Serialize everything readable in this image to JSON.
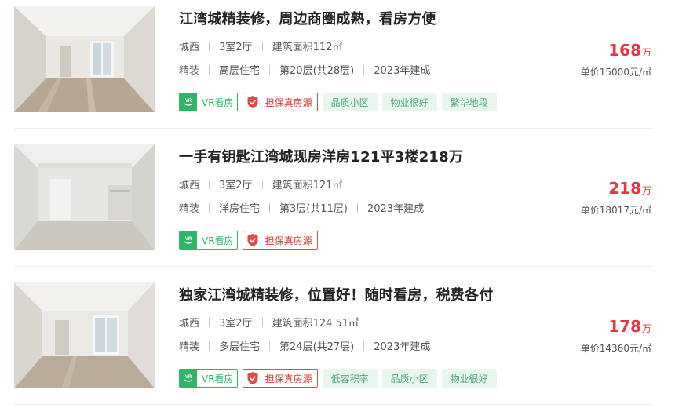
{
  "icons": {
    "vr": "vr-badge-icon",
    "guarantee": "shield-check-icon"
  },
  "colors": {
    "price_red": "#e8353f",
    "vr_green": "#2fb56a",
    "guard_red": "#e14a4a",
    "feature_bg": "#e8f6ee",
    "feature_text": "#4fa87a"
  },
  "listings": [
    {
      "title": "江湾城精装修，周边商圈成熟，看房方便",
      "district": "城西",
      "layout": "3室2厅",
      "area": "建筑面积112㎡",
      "decoration": "精装",
      "building_type": "高层住宅",
      "floor": "第20层(共28层)",
      "built": "2023年建成",
      "price_num": "168",
      "price_unit": "万",
      "unit_price": "单价15000元/㎡",
      "vr_label": "VR看房",
      "guarantee_label": "担保真房源",
      "features": [
        "品质小区",
        "物业很好",
        "繁华地段"
      ]
    },
    {
      "title": "一手有钥匙江湾城现房洋房121平3楼218万",
      "district": "城西",
      "layout": "3室2厅",
      "area": "建筑面积121㎡",
      "decoration": "精装",
      "building_type": "洋房住宅",
      "floor": "第3层(共11层)",
      "built": "2023年建成",
      "price_num": "218",
      "price_unit": "万",
      "unit_price": "单价18017元/㎡",
      "vr_label": "VR看房",
      "guarantee_label": "担保真房源",
      "features": []
    },
    {
      "title": "独家江湾城精装修，位置好！随时看房，税费各付",
      "district": "城西",
      "layout": "3室2厅",
      "area": "建筑面积124.51㎡",
      "decoration": "精装",
      "building_type": "多层住宅",
      "floor": "第24层(共27层)",
      "built": "2023年建成",
      "price_num": "178",
      "price_unit": "万",
      "unit_price": "单价14360元/㎡",
      "vr_label": "VR看房",
      "guarantee_label": "担保真房源",
      "features": [
        "低容积率",
        "品质小区",
        "物业很好"
      ]
    }
  ]
}
